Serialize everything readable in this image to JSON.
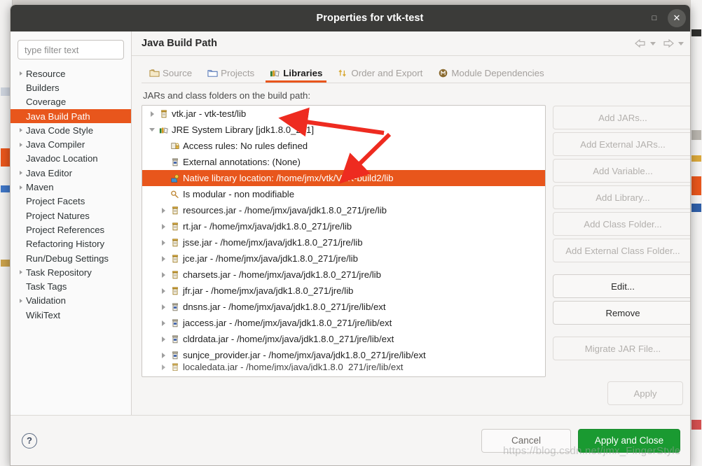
{
  "window": {
    "title": "Properties for vtk-test",
    "maximize_label": "□",
    "close_label": "✕"
  },
  "sidebar": {
    "filter_placeholder": "type filter text",
    "filter_value": "",
    "items": [
      {
        "label": "Resource",
        "expandable": true,
        "selected": false
      },
      {
        "label": "Builders",
        "expandable": false,
        "selected": false
      },
      {
        "label": "Coverage",
        "expandable": false,
        "selected": false
      },
      {
        "label": "Java Build Path",
        "expandable": false,
        "selected": true
      },
      {
        "label": "Java Code Style",
        "expandable": true,
        "selected": false
      },
      {
        "label": "Java Compiler",
        "expandable": true,
        "selected": false
      },
      {
        "label": "Javadoc Location",
        "expandable": false,
        "selected": false
      },
      {
        "label": "Java Editor",
        "expandable": true,
        "selected": false
      },
      {
        "label": "Maven",
        "expandable": true,
        "selected": false
      },
      {
        "label": "Project Facets",
        "expandable": false,
        "selected": false
      },
      {
        "label": "Project Natures",
        "expandable": false,
        "selected": false
      },
      {
        "label": "Project References",
        "expandable": false,
        "selected": false
      },
      {
        "label": "Refactoring History",
        "expandable": false,
        "selected": false
      },
      {
        "label": "Run/Debug Settings",
        "expandable": false,
        "selected": false
      },
      {
        "label": "Task Repository",
        "expandable": true,
        "selected": false
      },
      {
        "label": "Task Tags",
        "expandable": false,
        "selected": false
      },
      {
        "label": "Validation",
        "expandable": true,
        "selected": false
      },
      {
        "label": "WikiText",
        "expandable": false,
        "selected": false
      }
    ]
  },
  "pane": {
    "title": "Java Build Path",
    "nav": {
      "back_icon": "back-arrow-icon",
      "forward_icon": "forward-arrow-icon",
      "menu_icon": "vertical-dots-icon"
    },
    "tabs": [
      {
        "label": "Source",
        "icon": "source-folder-icon",
        "active": false
      },
      {
        "label": "Projects",
        "icon": "projects-folder-icon",
        "active": false
      },
      {
        "label": "Libraries",
        "icon": "libraries-books-icon",
        "active": true
      },
      {
        "label": "Order and Export",
        "icon": "order-export-arrows-icon",
        "active": false
      },
      {
        "label": "Module Dependencies",
        "icon": "module-circle-icon",
        "active": false
      }
    ],
    "list_caption": "JARs and class folders on the build path:"
  },
  "jar_tree": [
    {
      "label": "vtk.jar - vtk-test/lib",
      "indent": 0,
      "twisty": "closed",
      "icon": "jar-icon",
      "selected": false
    },
    {
      "label": "JRE System Library [jdk1.8.0_271]",
      "indent": 0,
      "twisty": "open",
      "icon": "jre-library-icon",
      "selected": false
    },
    {
      "label": "Access rules: No rules defined",
      "indent": 1,
      "twisty": "none",
      "icon": "access-rules-icon",
      "selected": false
    },
    {
      "label": "External annotations: (None)",
      "indent": 1,
      "twisty": "none",
      "icon": "annotation-jar-icon",
      "selected": false
    },
    {
      "label": "Native library location: /home/jmx/vtk/VTK-build2/lib",
      "indent": 1,
      "twisty": "none",
      "icon": "native-library-icon",
      "selected": true
    },
    {
      "label": "Is modular - non modifiable",
      "indent": 1,
      "twisty": "none",
      "icon": "module-key-icon",
      "selected": false
    },
    {
      "label": "resources.jar - /home/jmx/java/jdk1.8.0_271/jre/lib",
      "indent": 1,
      "twisty": "closed",
      "icon": "jar-icon",
      "selected": false
    },
    {
      "label": "rt.jar - /home/jmx/java/jdk1.8.0_271/jre/lib",
      "indent": 1,
      "twisty": "closed",
      "icon": "jar-icon",
      "selected": false
    },
    {
      "label": "jsse.jar - /home/jmx/java/jdk1.8.0_271/jre/lib",
      "indent": 1,
      "twisty": "closed",
      "icon": "jar-icon",
      "selected": false
    },
    {
      "label": "jce.jar - /home/jmx/java/jdk1.8.0_271/jre/lib",
      "indent": 1,
      "twisty": "closed",
      "icon": "jar-icon",
      "selected": false
    },
    {
      "label": "charsets.jar - /home/jmx/java/jdk1.8.0_271/jre/lib",
      "indent": 1,
      "twisty": "closed",
      "icon": "jar-icon",
      "selected": false
    },
    {
      "label": "jfr.jar - /home/jmx/java/jdk1.8.0_271/jre/lib",
      "indent": 1,
      "twisty": "closed",
      "icon": "jar-icon",
      "selected": false
    },
    {
      "label": "dnsns.jar - /home/jmx/java/jdk1.8.0_271/jre/lib/ext",
      "indent": 1,
      "twisty": "closed",
      "icon": "jar-blue-icon",
      "selected": false
    },
    {
      "label": "jaccess.jar - /home/jmx/java/jdk1.8.0_271/jre/lib/ext",
      "indent": 1,
      "twisty": "closed",
      "icon": "jar-blue-icon",
      "selected": false
    },
    {
      "label": "cldrdata.jar - /home/jmx/java/jdk1.8.0_271/jre/lib/ext",
      "indent": 1,
      "twisty": "closed",
      "icon": "jar-blue-icon",
      "selected": false
    },
    {
      "label": "sunjce_provider.jar - /home/jmx/java/jdk1.8.0_271/jre/lib/ext",
      "indent": 1,
      "twisty": "closed",
      "icon": "jar-blue-icon",
      "selected": false
    },
    {
      "label": "localedata.jar - /home/jmx/java/jdk1.8.0_271/jre/lib/ext",
      "indent": 1,
      "twisty": "closed",
      "icon": "jar-icon",
      "selected": false,
      "partial": true
    }
  ],
  "actions": [
    {
      "label": "Add JARs...",
      "enabled": false,
      "gap_after": false
    },
    {
      "label": "Add External JARs...",
      "enabled": false,
      "gap_after": false
    },
    {
      "label": "Add Variable...",
      "enabled": false,
      "gap_after": false
    },
    {
      "label": "Add Library...",
      "enabled": false,
      "gap_after": false
    },
    {
      "label": "Add Class Folder...",
      "enabled": false,
      "gap_after": false
    },
    {
      "label": "Add External Class Folder...",
      "enabled": false,
      "gap_after": true
    },
    {
      "label": "Edit...",
      "enabled": true,
      "gap_after": false
    },
    {
      "label": "Remove",
      "enabled": true,
      "gap_after": true
    },
    {
      "label": "Migrate JAR File...",
      "enabled": false,
      "gap_after": false
    }
  ],
  "footer": {
    "apply_label": "Apply",
    "help_label": "?",
    "cancel_label": "Cancel",
    "apply_and_close_label": "Apply and Close"
  },
  "watermark": "https://blog.csdn.net/jmx_FingerStyle",
  "colors": {
    "accent_orange": "#e8561c",
    "apply_green": "#1a9a31",
    "titlebar": "#3b3b39",
    "annotation_red": "#ee2b20"
  }
}
